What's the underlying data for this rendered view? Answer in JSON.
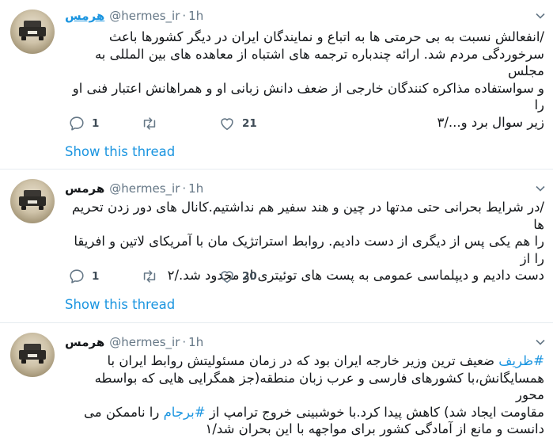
{
  "tweets": [
    {
      "name": "هرمس",
      "handle": "@hermes_ir",
      "dot": "·",
      "time": "1h",
      "lines": [
        "/انفعالش نسبت به بی حرمتی ها به اتباع و نمایندگان ایران در دیگر کشورها باعث",
        "سرخوردگی مردم شد. ارائه چندباره ترجمه های اشتباه از معاهده های بین المللی به مجلس",
        "و سواستفاده مذاکره کنندگان خارجی از ضعف دانش زبانی او و همراهانش اعتبار فنی او را",
        "زیر سوال برد و.../۳"
      ],
      "replies": "1",
      "retweets": "",
      "likes": "21",
      "show_thread": "Show this thread"
    },
    {
      "name": "هرمس",
      "handle": "@hermes_ir",
      "dot": "·",
      "time": "1h",
      "lines": [
        "/در شرایط بحرانی حتی مدتها در چین و هند سفیر هم نداشتیم.کانال های دور زدن تحریم ها",
        "را هم یکی پس از دیگری از دست دادیم. روابط استراتژیک مان با آمریکای لاتین و افریقا را از",
        "دست دادیم و دیپلماسی عمومی به پست های توئیتری او  محدود شد./۲"
      ],
      "replies": "1",
      "retweets": "",
      "likes": "20",
      "show_thread": "Show this thread"
    },
    {
      "name": "هرمس",
      "handle": "@hermes_ir",
      "dot": "·",
      "time": "1h",
      "hashtag1": "#ظریف",
      "line1_rest": " ضعیف ترین وزیر خارجه ایران بود که در زمان مسئولیتش روابط ایران با",
      "line2": "همسایگانش،با کشورهای فارسی و عرب زبان منطقه(جز همگرایی هایی که بواسطه محور",
      "line3": "مقاومت ایجاد شد) کاهش پیدا کرد.با خوشبینی خروج ترامپ از",
      "hashtag2": "#برجام",
      "line4_rest": " را ناممکن می",
      "line5": "دانست و مانع از آمادگی کشور برای مواجهه با این بحران شد/۱"
    }
  ],
  "colors": {
    "link": "#1b95e0",
    "muted": "#657786",
    "divider": "#e6ecf0"
  },
  "icons": [
    "reply-icon",
    "retweet-icon",
    "like-icon",
    "chevron-down-icon"
  ]
}
